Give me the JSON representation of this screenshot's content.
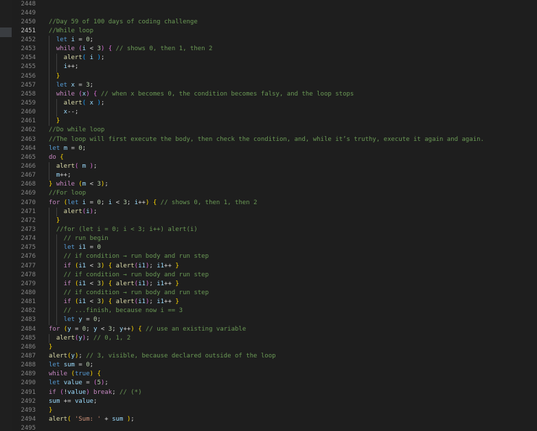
{
  "editor": {
    "active_line": "2451",
    "lines": [
      {
        "n": "2448",
        "i": 0,
        "t": []
      },
      {
        "n": "2449",
        "i": 0,
        "t": []
      },
      {
        "n": "2450",
        "i": 0,
        "t": [
          [
            "c",
            "//Day 59 of 100 days of coding challenge"
          ]
        ]
      },
      {
        "n": "2451",
        "i": 0,
        "t": [
          [
            "c",
            "//While loop"
          ]
        ]
      },
      {
        "n": "2452",
        "i": 1,
        "t": [
          [
            "st",
            "let "
          ],
          [
            "v",
            "i"
          ],
          [
            "p",
            " = "
          ],
          [
            "n",
            "0"
          ],
          [
            "p",
            ";"
          ]
        ]
      },
      {
        "n": "2453",
        "i": 1,
        "t": [
          [
            "kw",
            "while "
          ],
          [
            "b2",
            "("
          ],
          [
            "v",
            "i"
          ],
          [
            "p",
            " < "
          ],
          [
            "n",
            "3"
          ],
          [
            "b2",
            ")"
          ],
          [
            "p",
            " "
          ],
          [
            "b2",
            "{"
          ],
          [
            "c",
            " // shows 0, then 1, then 2"
          ]
        ]
      },
      {
        "n": "2454",
        "i": 2,
        "t": [
          [
            "f",
            "alert"
          ],
          [
            "b3",
            "("
          ],
          [
            "p",
            " "
          ],
          [
            "v",
            "i"
          ],
          [
            "p",
            " "
          ],
          [
            "b3",
            ")"
          ],
          [
            "p",
            ";"
          ]
        ]
      },
      {
        "n": "2455",
        "i": 2,
        "t": [
          [
            "v",
            "i"
          ],
          [
            "p",
            "++;"
          ]
        ]
      },
      {
        "n": "2456",
        "i": 1,
        "t": [
          [
            "b1",
            "}"
          ]
        ]
      },
      {
        "n": "2457",
        "i": 1,
        "t": [
          [
            "st",
            "let "
          ],
          [
            "v",
            "x"
          ],
          [
            "p",
            " = "
          ],
          [
            "n",
            "3"
          ],
          [
            "p",
            ";"
          ]
        ]
      },
      {
        "n": "2458",
        "i": 1,
        "t": [
          [
            "kw",
            "while "
          ],
          [
            "b2",
            "("
          ],
          [
            "v",
            "x"
          ],
          [
            "b2",
            ")"
          ],
          [
            "p",
            " "
          ],
          [
            "b2",
            "{"
          ],
          [
            "c",
            " // when x becomes 0, the condition becomes falsy, and the loop stops"
          ]
        ]
      },
      {
        "n": "2459",
        "i": 2,
        "t": [
          [
            "f",
            "alert"
          ],
          [
            "b3",
            "("
          ],
          [
            "p",
            " "
          ],
          [
            "v",
            "x"
          ],
          [
            "p",
            " "
          ],
          [
            "b3",
            ")"
          ],
          [
            "p",
            ";"
          ]
        ]
      },
      {
        "n": "2460",
        "i": 2,
        "t": [
          [
            "v",
            "x"
          ],
          [
            "p",
            "--;"
          ]
        ]
      },
      {
        "n": "2461",
        "i": 1,
        "t": [
          [
            "b1",
            "}"
          ]
        ]
      },
      {
        "n": "2462",
        "i": 0,
        "t": [
          [
            "c",
            "//Do while loop"
          ]
        ]
      },
      {
        "n": "2463",
        "i": 0,
        "t": [
          [
            "c",
            "//The loop will first execute the body, then check the condition, and, while it’s truthy, execute it again and again."
          ]
        ]
      },
      {
        "n": "2464",
        "i": 0,
        "t": [
          [
            "st",
            "let "
          ],
          [
            "v",
            "m"
          ],
          [
            "p",
            " = "
          ],
          [
            "n",
            "0"
          ],
          [
            "p",
            ";"
          ]
        ]
      },
      {
        "n": "2465",
        "i": 0,
        "t": [
          [
            "kw",
            "do "
          ],
          [
            "b1",
            "{"
          ]
        ]
      },
      {
        "n": "2466",
        "i": 1,
        "t": [
          [
            "f",
            "alert"
          ],
          [
            "b2",
            "("
          ],
          [
            "p",
            " "
          ],
          [
            "v",
            "m"
          ],
          [
            "p",
            " "
          ],
          [
            "b2",
            ")"
          ],
          [
            "p",
            ";"
          ]
        ]
      },
      {
        "n": "2467",
        "i": 1,
        "t": [
          [
            "v",
            "m"
          ],
          [
            "p",
            "++;"
          ]
        ]
      },
      {
        "n": "2468",
        "i": 0,
        "t": [
          [
            "b1",
            "}"
          ],
          [
            "kw",
            " while "
          ],
          [
            "b1",
            "("
          ],
          [
            "v",
            "m"
          ],
          [
            "p",
            " < "
          ],
          [
            "n",
            "3"
          ],
          [
            "b1",
            ")"
          ],
          [
            "p",
            ";"
          ]
        ]
      },
      {
        "n": "2469",
        "i": 0,
        "t": [
          [
            "c",
            "//For loop"
          ]
        ]
      },
      {
        "n": "2470",
        "i": 0,
        "t": [
          [
            "kw",
            "for "
          ],
          [
            "b1",
            "("
          ],
          [
            "st",
            "let "
          ],
          [
            "v",
            "i"
          ],
          [
            "p",
            " = "
          ],
          [
            "n",
            "0"
          ],
          [
            "p",
            "; "
          ],
          [
            "v",
            "i"
          ],
          [
            "p",
            " < "
          ],
          [
            "n",
            "3"
          ],
          [
            "p",
            "; "
          ],
          [
            "v",
            "i"
          ],
          [
            "p",
            "++"
          ],
          [
            "b1",
            ")"
          ],
          [
            "p",
            " "
          ],
          [
            "b1",
            "{"
          ],
          [
            "c",
            " // shows 0, then 1, then 2"
          ]
        ]
      },
      {
        "n": "2471",
        "i": 2,
        "t": [
          [
            "f",
            "alert"
          ],
          [
            "b2",
            "("
          ],
          [
            "v",
            "i"
          ],
          [
            "b2",
            ")"
          ],
          [
            "p",
            ";"
          ]
        ]
      },
      {
        "n": "2472",
        "i": 1,
        "t": [
          [
            "b1",
            "}"
          ]
        ]
      },
      {
        "n": "2473",
        "i": 1,
        "t": [
          [
            "c",
            "//for (let i = 0; i < 3; i++) alert(i)"
          ]
        ]
      },
      {
        "n": "2474",
        "i": 2,
        "t": [
          [
            "c",
            "// run begin"
          ]
        ]
      },
      {
        "n": "2475",
        "i": 2,
        "t": [
          [
            "st",
            "let "
          ],
          [
            "v",
            "i1"
          ],
          [
            "p",
            " = "
          ],
          [
            "n",
            "0"
          ]
        ]
      },
      {
        "n": "2476",
        "i": 2,
        "t": [
          [
            "c",
            "// if condition → run body and run step"
          ]
        ]
      },
      {
        "n": "2477",
        "i": 2,
        "t": [
          [
            "kw",
            "if "
          ],
          [
            "b1",
            "("
          ],
          [
            "v",
            "i1"
          ],
          [
            "p",
            " < "
          ],
          [
            "n",
            "3"
          ],
          [
            "b1",
            ")"
          ],
          [
            "p",
            " "
          ],
          [
            "b1",
            "{"
          ],
          [
            "p",
            " "
          ],
          [
            "f",
            "alert"
          ],
          [
            "b2",
            "("
          ],
          [
            "v",
            "i1"
          ],
          [
            "b2",
            ")"
          ],
          [
            "p",
            "; "
          ],
          [
            "v",
            "i1"
          ],
          [
            "p",
            "++ "
          ],
          [
            "b1",
            "}"
          ]
        ]
      },
      {
        "n": "2478",
        "i": 2,
        "t": [
          [
            "c",
            "// if condition → run body and run step"
          ]
        ]
      },
      {
        "n": "2479",
        "i": 2,
        "t": [
          [
            "kw",
            "if "
          ],
          [
            "b1",
            "("
          ],
          [
            "v",
            "i1"
          ],
          [
            "p",
            " < "
          ],
          [
            "n",
            "3"
          ],
          [
            "b1",
            ")"
          ],
          [
            "p",
            " "
          ],
          [
            "b1",
            "{"
          ],
          [
            "p",
            " "
          ],
          [
            "f",
            "alert"
          ],
          [
            "b2",
            "("
          ],
          [
            "v",
            "i1"
          ],
          [
            "b2",
            ")"
          ],
          [
            "p",
            "; "
          ],
          [
            "v",
            "i1"
          ],
          [
            "p",
            "++ "
          ],
          [
            "b1",
            "}"
          ]
        ]
      },
      {
        "n": "2480",
        "i": 2,
        "t": [
          [
            "c",
            "// if condition → run body and run step"
          ]
        ]
      },
      {
        "n": "2481",
        "i": 2,
        "t": [
          [
            "kw",
            "if "
          ],
          [
            "b1",
            "("
          ],
          [
            "v",
            "i1"
          ],
          [
            "p",
            " < "
          ],
          [
            "n",
            "3"
          ],
          [
            "b1",
            ")"
          ],
          [
            "p",
            " "
          ],
          [
            "b1",
            "{"
          ],
          [
            "p",
            " "
          ],
          [
            "f",
            "alert"
          ],
          [
            "b2",
            "("
          ],
          [
            "v",
            "i1"
          ],
          [
            "b2",
            ")"
          ],
          [
            "p",
            "; "
          ],
          [
            "v",
            "i1"
          ],
          [
            "p",
            "++ "
          ],
          [
            "b1",
            "}"
          ]
        ]
      },
      {
        "n": "2482",
        "i": 2,
        "t": [
          [
            "c",
            "// ...finish, because now i == 3"
          ]
        ]
      },
      {
        "n": "2483",
        "i": 2,
        "t": [
          [
            "st",
            "let "
          ],
          [
            "v",
            "y"
          ],
          [
            "p",
            " = "
          ],
          [
            "n",
            "0"
          ],
          [
            "p",
            ";"
          ]
        ]
      },
      {
        "n": "2484",
        "i": 0,
        "t": [
          [
            "kw",
            "for "
          ],
          [
            "b1",
            "("
          ],
          [
            "v",
            "y"
          ],
          [
            "p",
            " = "
          ],
          [
            "n",
            "0"
          ],
          [
            "p",
            "; "
          ],
          [
            "v",
            "y"
          ],
          [
            "p",
            " < "
          ],
          [
            "n",
            "3"
          ],
          [
            "p",
            "; "
          ],
          [
            "v",
            "y"
          ],
          [
            "p",
            "++"
          ],
          [
            "b1",
            ")"
          ],
          [
            "p",
            " "
          ],
          [
            "b1",
            "{"
          ],
          [
            "c",
            " // use an existing variable"
          ]
        ]
      },
      {
        "n": "2485",
        "i": 1,
        "t": [
          [
            "f",
            "alert"
          ],
          [
            "b2",
            "("
          ],
          [
            "v",
            "y"
          ],
          [
            "b2",
            ")"
          ],
          [
            "p",
            "; "
          ],
          [
            "c",
            "// 0, 1, 2"
          ]
        ]
      },
      {
        "n": "2486",
        "i": 0,
        "t": [
          [
            "b1",
            "}"
          ]
        ]
      },
      {
        "n": "2487",
        "i": 0,
        "t": [
          [
            "f",
            "alert"
          ],
          [
            "b1",
            "("
          ],
          [
            "v",
            "y"
          ],
          [
            "b1",
            ")"
          ],
          [
            "p",
            "; "
          ],
          [
            "c",
            "// 3, visible, because declared outside of the loop"
          ]
        ]
      },
      {
        "n": "2488",
        "i": 0,
        "t": [
          [
            "st",
            "let "
          ],
          [
            "v",
            "sum"
          ],
          [
            "p",
            " = "
          ],
          [
            "n",
            "0"
          ],
          [
            "p",
            ";"
          ]
        ]
      },
      {
        "n": "2489",
        "i": 0,
        "t": [
          [
            "kw",
            "while "
          ],
          [
            "b1",
            "("
          ],
          [
            "st",
            "true"
          ],
          [
            "b1",
            ")"
          ],
          [
            "p",
            " "
          ],
          [
            "b1",
            "{"
          ]
        ]
      },
      {
        "n": "2490",
        "i": 0,
        "t": [
          [
            "st",
            "let "
          ],
          [
            "v",
            "value"
          ],
          [
            "p",
            " = "
          ],
          [
            "b2",
            "("
          ],
          [
            "n",
            "5"
          ],
          [
            "b2",
            ")"
          ],
          [
            "p",
            ";"
          ]
        ]
      },
      {
        "n": "2491",
        "i": 0,
        "t": [
          [
            "kw",
            "if "
          ],
          [
            "b2",
            "("
          ],
          [
            "p",
            "!"
          ],
          [
            "v",
            "value"
          ],
          [
            "b2",
            ")"
          ],
          [
            "kw",
            " break"
          ],
          [
            "p",
            "; "
          ],
          [
            "c",
            "// (*)"
          ]
        ]
      },
      {
        "n": "2492",
        "i": 0,
        "t": [
          [
            "v",
            "sum"
          ],
          [
            "p",
            " += "
          ],
          [
            "v",
            "value"
          ],
          [
            "p",
            ";"
          ]
        ]
      },
      {
        "n": "2493",
        "i": 0,
        "t": [
          [
            "b1",
            "}"
          ]
        ]
      },
      {
        "n": "2494",
        "i": 0,
        "t": [
          [
            "f",
            "alert"
          ],
          [
            "b1",
            "("
          ],
          [
            "p",
            " "
          ],
          [
            "s",
            "'Sum: '"
          ],
          [
            "p",
            " + "
          ],
          [
            "v",
            "sum"
          ],
          [
            "p",
            " "
          ],
          [
            "b1",
            ")"
          ],
          [
            "p",
            ";"
          ]
        ]
      },
      {
        "n": "2495",
        "i": 0,
        "t": []
      }
    ]
  }
}
